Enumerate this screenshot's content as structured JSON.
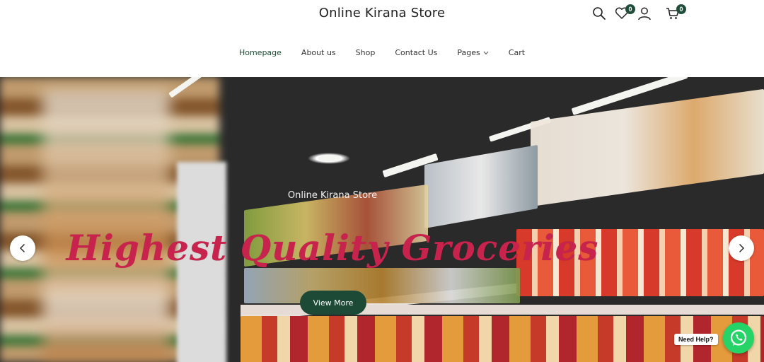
{
  "header": {
    "site_title": "Online Kirana Store",
    "wishlist_count": "0",
    "cart_count": "0",
    "icons": [
      "search-icon",
      "heart-icon",
      "user-icon",
      "cart-icon"
    ]
  },
  "nav": {
    "items": [
      {
        "label": "Homepage",
        "active": true
      },
      {
        "label": "About us"
      },
      {
        "label": "Shop"
      },
      {
        "label": "Contact Us"
      },
      {
        "label": "Pages",
        "dropdown": true
      },
      {
        "label": "Cart"
      }
    ]
  },
  "hero": {
    "subtitle": "Online Kirana Store",
    "title": "Highest Quality Groceries",
    "cta_label": "View More",
    "accent_color": "#c8234c",
    "button_color": "#1d4a37"
  },
  "help": {
    "label": "Need Help?",
    "icon": "whatsapp-icon"
  }
}
